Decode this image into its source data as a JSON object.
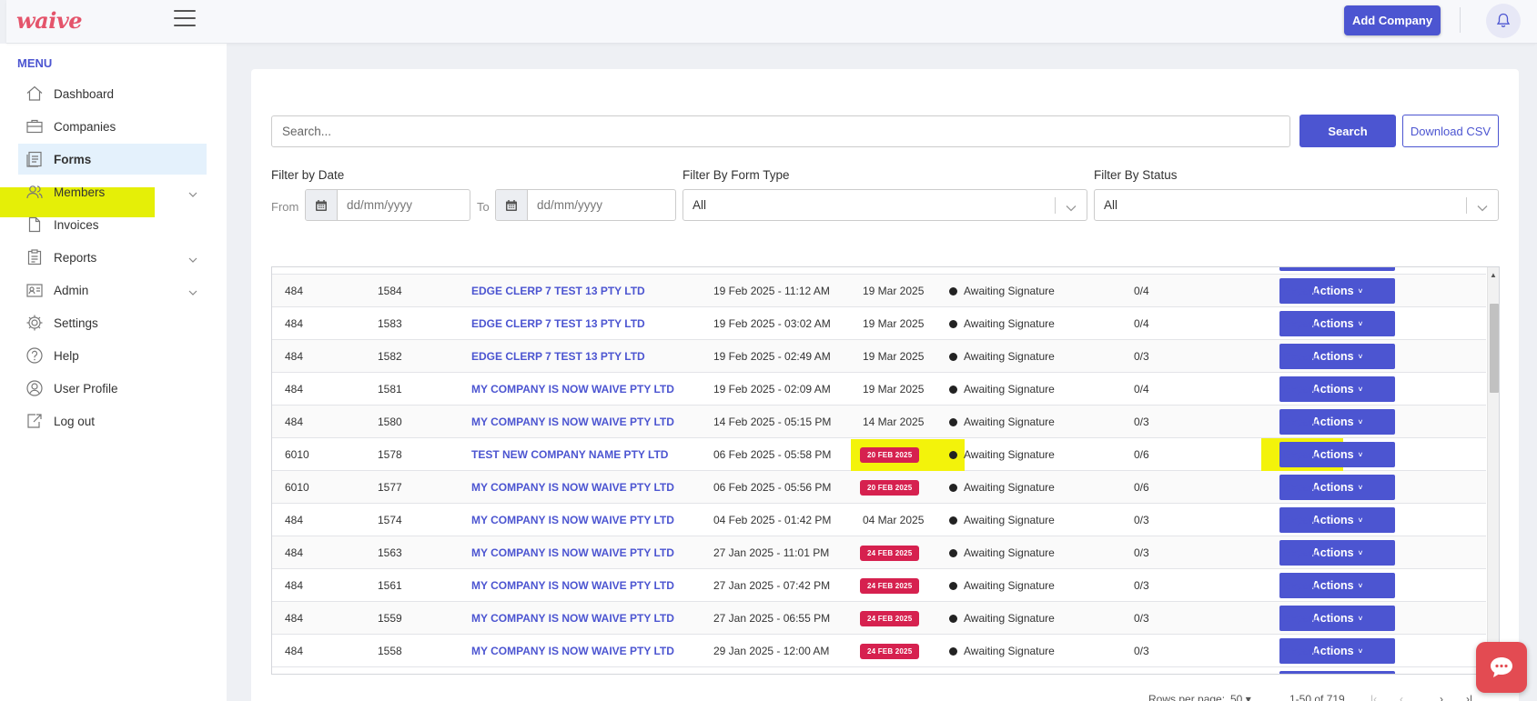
{
  "header": {
    "logo": "waive",
    "add_company_label": "Add Company"
  },
  "sidebar": {
    "menu_label": "MENU",
    "items": [
      {
        "label": "Dashboard",
        "icon": "home-icon"
      },
      {
        "label": "Companies",
        "icon": "briefcase-icon"
      },
      {
        "label": "Forms",
        "icon": "forms-icon",
        "active": true
      },
      {
        "label": "Members",
        "icon": "users-icon",
        "has_submenu": true
      },
      {
        "label": "Invoices",
        "icon": "file-icon"
      },
      {
        "label": "Reports",
        "icon": "clipboard-icon",
        "has_submenu": true
      },
      {
        "label": "Admin",
        "icon": "id-card-icon",
        "has_submenu": true
      },
      {
        "label": "Settings",
        "icon": "gear-icon"
      },
      {
        "label": "Help",
        "icon": "help-icon"
      },
      {
        "label": "User Profile",
        "icon": "user-icon"
      },
      {
        "label": "Log out",
        "icon": "logout-icon"
      }
    ]
  },
  "search": {
    "placeholder": "Search...",
    "search_label": "Search",
    "csv_label": "Download CSV"
  },
  "filters": {
    "date_label": "Filter by Date",
    "from_label": "From",
    "to_label": "To",
    "date_placeholder": "dd/mm/yyyy",
    "form_type_label": "Filter By Form Type",
    "form_type_value": "All",
    "status_label": "Filter By Status",
    "status_value": "All"
  },
  "table": {
    "actions_label": "Actions",
    "expand_label": "Expand",
    "rows": [
      {
        "id": "484",
        "form": "1584",
        "company": "EDGE CLERP 7 TEST 13 PTY LTD",
        "created": "19 Feb 2025 - 11:12 AM",
        "due": "19 Mar 2025",
        "due_badge": false,
        "status": "Awaiting Signature",
        "signed": "0/4"
      },
      {
        "id": "484",
        "form": "1583",
        "company": "EDGE CLERP 7 TEST 13 PTY LTD",
        "created": "19 Feb 2025 - 03:02 AM",
        "due": "19 Mar 2025",
        "due_badge": false,
        "status": "Awaiting Signature",
        "signed": "0/4"
      },
      {
        "id": "484",
        "form": "1582",
        "company": "EDGE CLERP 7 TEST 13 PTY LTD",
        "created": "19 Feb 2025 - 02:49 AM",
        "due": "19 Mar 2025",
        "due_badge": false,
        "status": "Awaiting Signature",
        "signed": "0/3"
      },
      {
        "id": "484",
        "form": "1581",
        "company": "MY COMPANY IS NOW WAIVE PTY LTD",
        "created": "19 Feb 2025 - 02:09 AM",
        "due": "19 Mar 2025",
        "due_badge": false,
        "status": "Awaiting Signature",
        "signed": "0/4"
      },
      {
        "id": "484",
        "form": "1580",
        "company": "MY COMPANY IS NOW WAIVE PTY LTD",
        "created": "14 Feb 2025 - 05:15 PM",
        "due": "14 Mar 2025",
        "due_badge": false,
        "status": "Awaiting Signature",
        "signed": "0/3"
      },
      {
        "id": "6010",
        "form": "1578",
        "company": "TEST NEW COMPANY NAME PTY LTD",
        "created": "06 Feb 2025 - 05:58 PM",
        "due": "20 FEB 2025",
        "due_badge": true,
        "status": "Awaiting Signature",
        "signed": "0/6",
        "highlight": true
      },
      {
        "id": "6010",
        "form": "1577",
        "company": "MY COMPANY IS NOW WAIVE PTY LTD",
        "created": "06 Feb 2025 - 05:56 PM",
        "due": "20 FEB 2025",
        "due_badge": true,
        "status": "Awaiting Signature",
        "signed": "0/6"
      },
      {
        "id": "484",
        "form": "1574",
        "company": "MY COMPANY IS NOW WAIVE PTY LTD",
        "created": "04 Feb 2025 - 01:42 PM",
        "due": "04 Mar 2025",
        "due_badge": false,
        "status": "Awaiting Signature",
        "signed": "0/3"
      },
      {
        "id": "484",
        "form": "1563",
        "company": "MY COMPANY IS NOW WAIVE PTY LTD",
        "created": "27 Jan 2025 - 11:01 PM",
        "due": "24 FEB 2025",
        "due_badge": true,
        "status": "Awaiting Signature",
        "signed": "0/3"
      },
      {
        "id": "484",
        "form": "1561",
        "company": "MY COMPANY IS NOW WAIVE PTY LTD",
        "created": "27 Jan 2025 - 07:42 PM",
        "due": "24 FEB 2025",
        "due_badge": true,
        "status": "Awaiting Signature",
        "signed": "0/3"
      },
      {
        "id": "484",
        "form": "1559",
        "company": "MY COMPANY IS NOW WAIVE PTY LTD",
        "created": "27 Jan 2025 - 06:55 PM",
        "due": "24 FEB 2025",
        "due_badge": true,
        "status": "Awaiting Signature",
        "signed": "0/3"
      },
      {
        "id": "484",
        "form": "1558",
        "company": "MY COMPANY IS NOW WAIVE PTY LTD",
        "created": "29 Jan 2025 - 12:00 AM",
        "due": "24 FEB 2025",
        "due_badge": true,
        "status": "Awaiting Signature",
        "signed": "0/3"
      }
    ]
  },
  "pagination": {
    "rows_per_page_label": "Rows per page:",
    "rows_per_page_value": "50",
    "range": "1-50 of 719"
  },
  "colors": {
    "accent": "#4c55d1",
    "badge": "#d6214f",
    "highlight": "#f3f30a",
    "logo": "#e4546b"
  }
}
